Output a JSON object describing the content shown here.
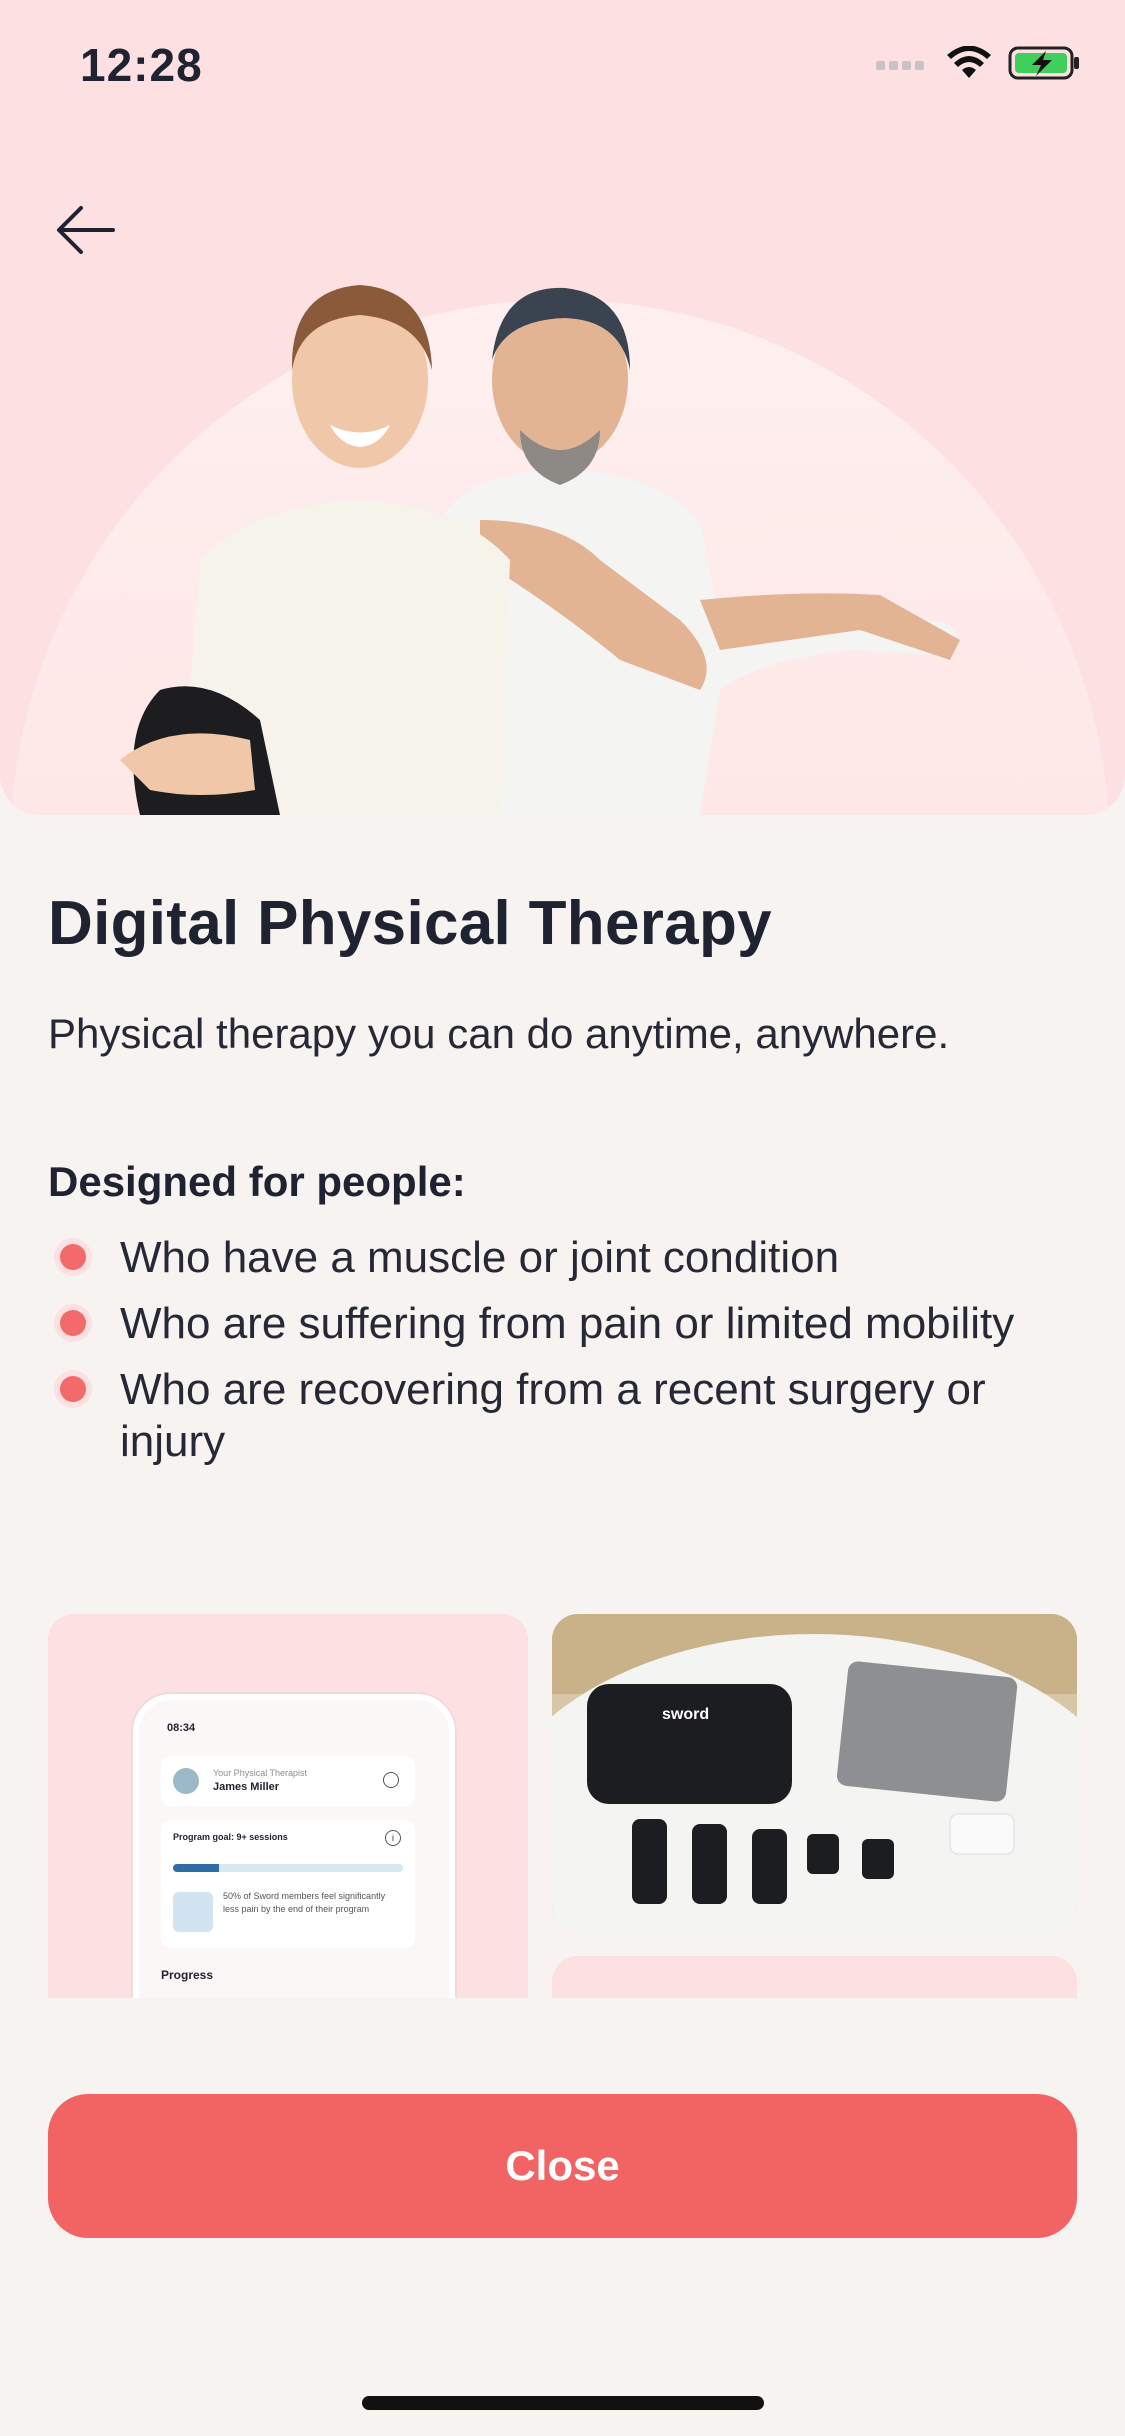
{
  "status_bar": {
    "time": "12:28"
  },
  "header": {
    "back_icon": "arrow-left-icon"
  },
  "content": {
    "title": "Digital Physical Therapy",
    "subtitle": "Physical therapy you can do anytime, anywhere.",
    "section_heading": "Designed for people:",
    "bullets": [
      "Who have a muscle or joint condition",
      "Who are suffering from pain or limited mobility",
      "Who are recovering from a recent surgery or injury"
    ]
  },
  "app_preview": {
    "time": "08:34",
    "therapist_role": "Your Physical Therapist",
    "therapist_name": "James Miller",
    "goal_label": "Program goal: 9+ sessions",
    "goal_progress": 0.2,
    "goal_note": "50% of Sword members feel significantly less pain by the end of their program",
    "progress_label": "Progress"
  },
  "kit_image": {
    "brand": "sword"
  },
  "footer": {
    "close_label": "Close"
  },
  "colors": {
    "accent": "#F26463",
    "hero_bg": "#FDE0E1",
    "page_bg": "#F7F3F1",
    "text": "#1F2230"
  }
}
